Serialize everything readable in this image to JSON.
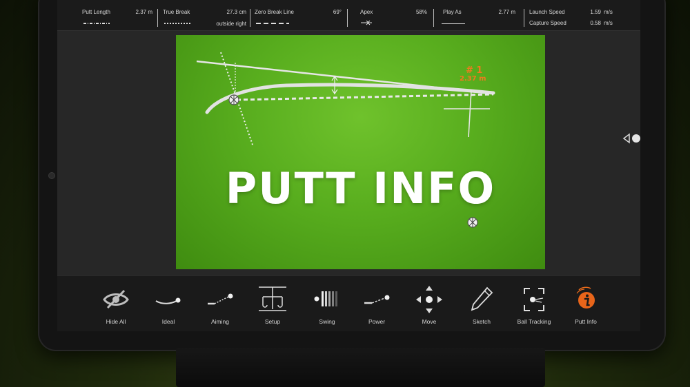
{
  "info_bar": {
    "putt_length": {
      "label": "Putt Length",
      "value": "2.37 m"
    },
    "true_break": {
      "label": "True Break",
      "value": "27.3 cm",
      "detail": "outside right"
    },
    "zero_break_line": {
      "label": "Zero Break Line",
      "value": "69°"
    },
    "apex": {
      "label": "Apex",
      "value": "58%"
    },
    "play_as": {
      "label": "Play As",
      "value": "2.77 m"
    },
    "launch_speed": {
      "label": "Launch Speed",
      "value": "1.59",
      "unit": "m/s"
    },
    "capture_speed": {
      "label": "Capture Speed",
      "value": "0.58",
      "unit": "m/s"
    }
  },
  "green": {
    "title": "PUTT INFO",
    "marker_number": "# 1",
    "marker_distance": "2.37 m",
    "colors": {
      "green": "#58ad1e",
      "accent": "#f07a1e"
    }
  },
  "toolbar": {
    "items": [
      {
        "label": "Hide All",
        "icon": "eye-slash-icon"
      },
      {
        "label": "Ideal",
        "icon": "ideal-path-icon"
      },
      {
        "label": "Aiming",
        "icon": "aiming-icon"
      },
      {
        "label": "Setup",
        "icon": "setup-icon"
      },
      {
        "label": "Swing",
        "icon": "swing-icon"
      },
      {
        "label": "Power",
        "icon": "power-icon"
      },
      {
        "label": "Move",
        "icon": "move-arrows-icon"
      },
      {
        "label": "Sketch",
        "icon": "pencil-icon"
      },
      {
        "label": "Ball Tracking",
        "icon": "ball-tracking-icon"
      },
      {
        "label": "Putt Info",
        "icon": "info-icon"
      }
    ]
  }
}
